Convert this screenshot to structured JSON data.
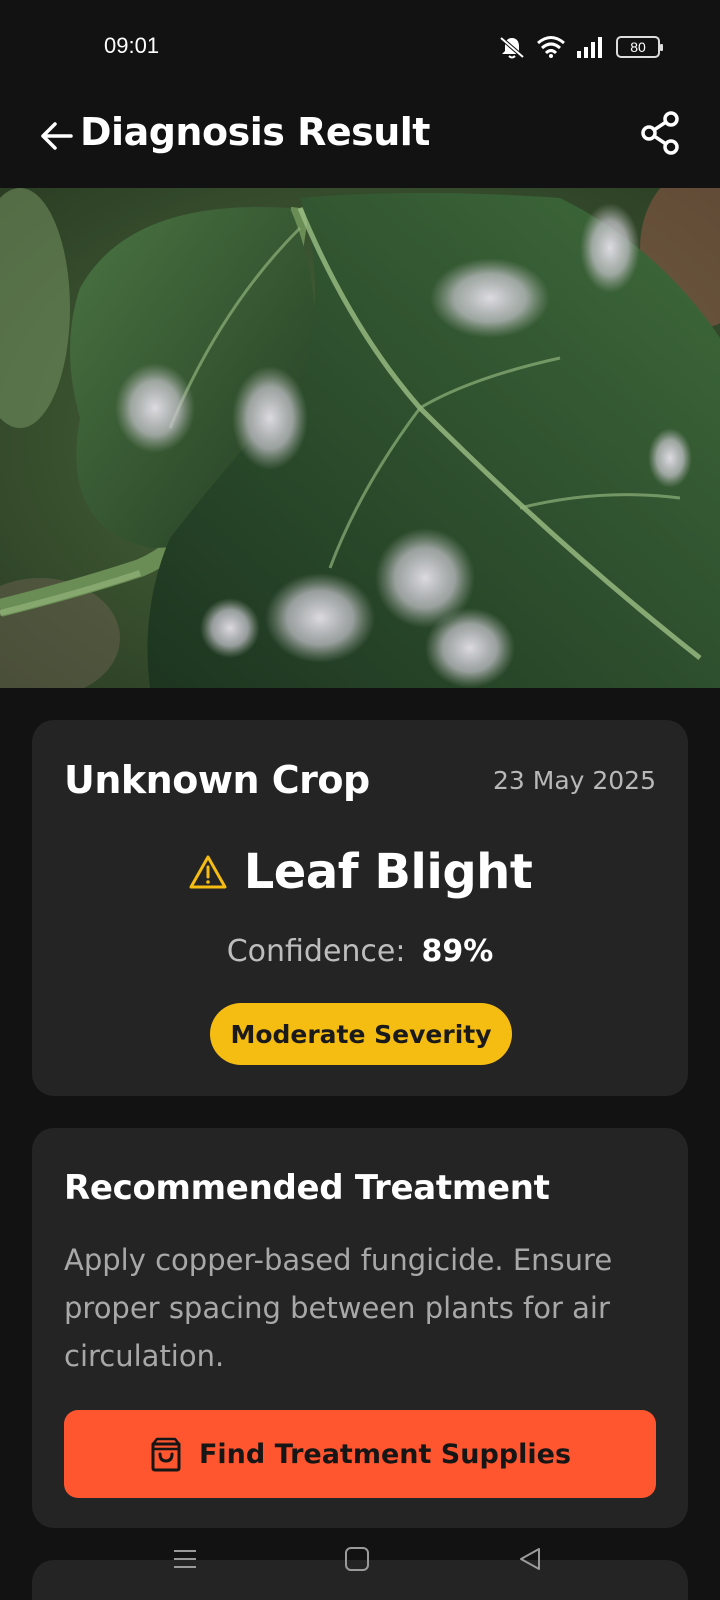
{
  "status_bar": {
    "time": "09:01",
    "battery": "80",
    "icons": [
      "mute-icon",
      "wifi-icon",
      "signal-icon",
      "battery-icon"
    ]
  },
  "header": {
    "title": "Diagnosis Result",
    "back_icon": "arrow-left-icon",
    "share_icon": "share-icon"
  },
  "diagnosis": {
    "crop": "Unknown Crop",
    "date": "23 May 2025",
    "disease": "Leaf Blight",
    "warning_icon": "warning-triangle-icon",
    "confidence_label": "Confidence:",
    "confidence_value": "89%",
    "severity": "Moderate Severity"
  },
  "treatment": {
    "title": "Recommended Treatment",
    "text": "Apply copper-based fungicide. Ensure proper spacing between plants for air circulation.",
    "button_label": "Find Treatment Supplies",
    "button_icon": "shopping-bag-icon"
  },
  "navigation": {
    "items": [
      "menu-icon",
      "home-icon",
      "back-icon"
    ]
  },
  "colors": {
    "background": "#121212",
    "card": "#242424",
    "severity": "#f5bd12",
    "primary_button": "#ff5630",
    "warning_icon": "#f5bd12"
  }
}
